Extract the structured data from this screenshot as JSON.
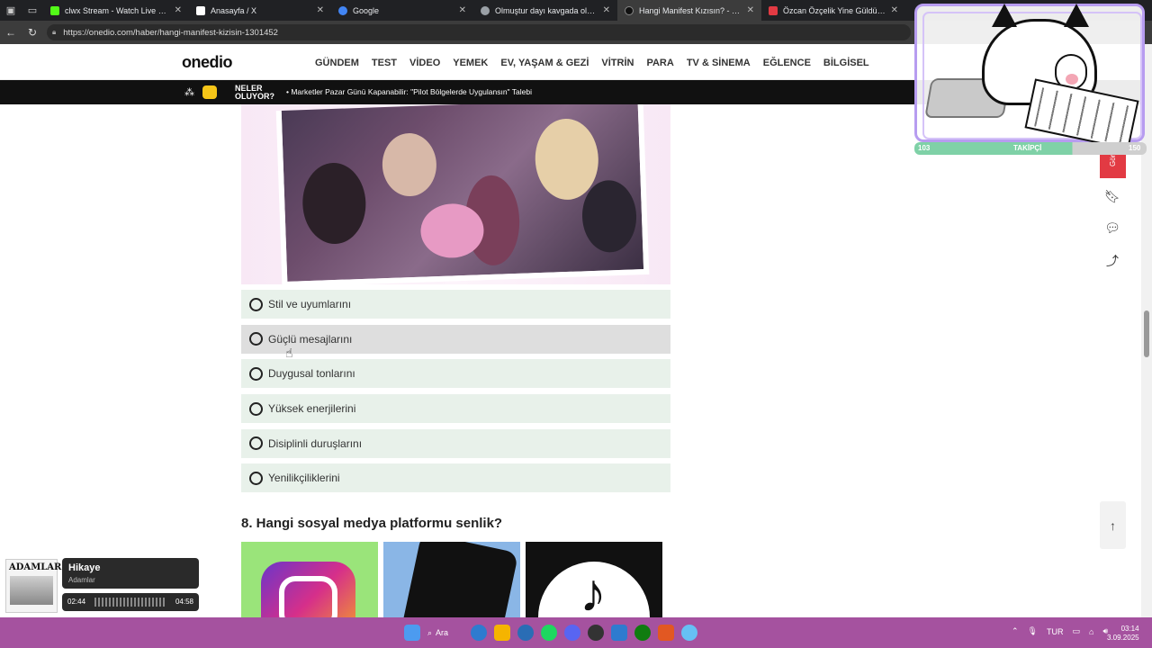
{
  "browser": {
    "tabs": [
      {
        "title": "clwx Stream - Watch Live on Kick",
        "color": "#53fc18"
      },
      {
        "title": "Anasayfa / X",
        "color": "#ffffff"
      },
      {
        "title": "Google",
        "color": "#4285f4"
      },
      {
        "title": "Olmuştur dayı kavgada olur - Ara",
        "color": "#9aa0a6"
      },
      {
        "title": "Hangi Manifest Kızısın? - Onedio",
        "color": "#111111"
      },
      {
        "title": "Özcan Özçelik Yine Güldürmedi",
        "color": "#e23a43"
      }
    ],
    "url": "https://onedio.com/haber/hangi-manifest-kizisin-1301452"
  },
  "site": {
    "logo": "onedio",
    "nav": [
      "GÜNDEM",
      "TEST",
      "VİDEO",
      "YEMEK",
      "EV, YAŞAM & GEZİ",
      "VİTRİN",
      "PARA",
      "TV & SİNEMA",
      "EĞLENCE",
      "BİLGİSEL"
    ]
  },
  "ticker": {
    "label_line1": "NELER",
    "label_line2": "OLUYOR?",
    "headline": "Marketler Pazar Günü Kapanabilir: \"Pilot Bölgelerde Uygulansın\" Talebi"
  },
  "quiz": {
    "options": [
      "Stil ve uyumlarını",
      "Güçlü mesajlarını",
      "Duygusal tonlarını",
      "Yüksek enerjilerini",
      "Disiplinli duruşlarını",
      "Yenilikçiliklerini"
    ],
    "next_question": "8. Hangi sosyal medya platformu senlik?"
  },
  "overlay": {
    "left_count": "103",
    "label": "TAKİPÇİ",
    "right_count": "150"
  },
  "side": {
    "red_tab": "Görüş"
  },
  "media": {
    "album_title": "ADAMLAR",
    "track": "Hikaye",
    "artist": "Adamlar",
    "elapsed": "02:44",
    "total": "04:58"
  },
  "taskbar": {
    "search": "Ara",
    "lang": "TUR",
    "time": "03:14",
    "date": "3.09.2025",
    "icons": [
      "#4c9bf0",
      "#f5b400",
      "#2a6db5",
      "#1ed760",
      "#5865f2",
      "#333333",
      "#2e7bcf",
      "#107c10",
      "#e25822",
      "#66c0f4"
    ]
  }
}
